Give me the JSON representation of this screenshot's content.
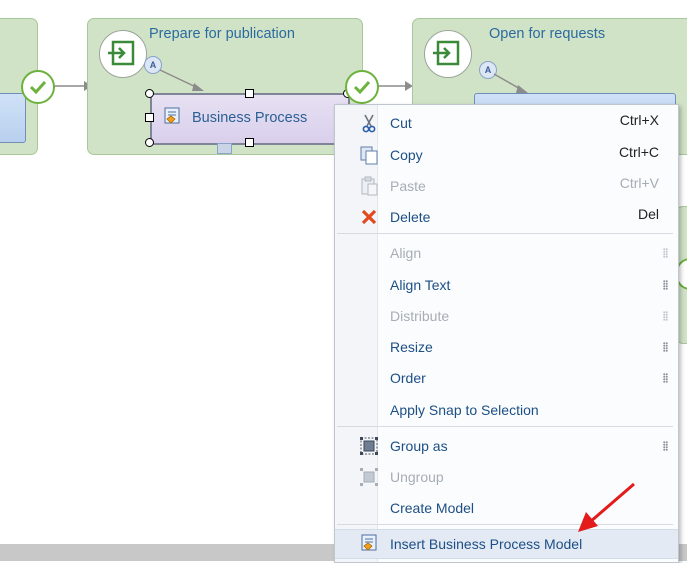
{
  "stages": [
    {
      "title": ""
    },
    {
      "title": "Prepare for publication"
    },
    {
      "title": "Open for requests"
    }
  ],
  "selected_task": {
    "label": "Business Process"
  },
  "context_menu": {
    "items": [
      {
        "id": "cut",
        "label": "Cut",
        "shortcut": "Ctrl+X",
        "icon": "scissors-icon",
        "enabled": true
      },
      {
        "id": "copy",
        "label": "Copy",
        "shortcut": "Ctrl+C",
        "icon": "copy-icon",
        "enabled": true
      },
      {
        "id": "paste",
        "label": "Paste",
        "shortcut": "Ctrl+V",
        "icon": "paste-icon",
        "enabled": false
      },
      {
        "id": "delete",
        "label": "Delete",
        "shortcut": "Del",
        "icon": "delete-x-icon",
        "enabled": true
      },
      {
        "id": "align",
        "label": "Align",
        "submenu": true,
        "enabled": false
      },
      {
        "id": "align-text",
        "label": "Align Text",
        "submenu": true,
        "enabled": true
      },
      {
        "id": "distribute",
        "label": "Distribute",
        "submenu": true,
        "enabled": false
      },
      {
        "id": "resize",
        "label": "Resize",
        "submenu": true,
        "enabled": true
      },
      {
        "id": "order",
        "label": "Order",
        "submenu": true,
        "enabled": true
      },
      {
        "id": "apply-snap",
        "label": "Apply Snap to Selection",
        "enabled": true
      },
      {
        "id": "group-as",
        "label": "Group as",
        "submenu": true,
        "icon": "group-icon",
        "enabled": true
      },
      {
        "id": "ungroup",
        "label": "Ungroup",
        "icon": "ungroup-icon",
        "enabled": false
      },
      {
        "id": "create-model",
        "label": "Create Model",
        "enabled": true
      },
      {
        "id": "insert-bpm",
        "label": "Insert Business Process Model",
        "icon": "business-process-icon",
        "enabled": true,
        "highlighted": true
      }
    ]
  },
  "colors": {
    "stage_fill": "#d1e3c6",
    "check_green": "#6cb23c",
    "annotation_arrow": "#e31b1b",
    "menu_text": "#1c4f86"
  }
}
